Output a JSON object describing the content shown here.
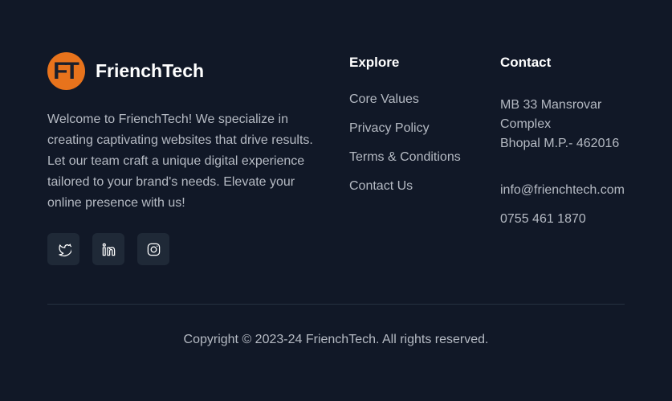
{
  "brand": {
    "logo_mark": "FT",
    "name": "FrienchTech",
    "logo_color": "#e8731c"
  },
  "about": {
    "text": "Welcome to FrienchTech! We specialize in creating captivating websites that drive results. Let our team craft a unique digital experience tailored to your brand's needs. Elevate your online presence with us!"
  },
  "socials": [
    {
      "icon": "twitter-icon"
    },
    {
      "icon": "linkedin-icon"
    },
    {
      "icon": "instagram-icon"
    }
  ],
  "explore": {
    "title": "Explore",
    "links": [
      "Core Values",
      "Privacy Policy",
      "Terms & Conditions",
      "Contact Us"
    ]
  },
  "contact": {
    "title": "Contact",
    "address_line1": "MB 33 Mansrovar",
    "address_line2": "Complex",
    "address_line3": "Bhopal M.P.- 462016",
    "email": "info@frienchtech.com",
    "phone": "0755 461 1870"
  },
  "footer": {
    "copyright": "Copyright © 2023-24 FrienchTech. All rights reserved."
  },
  "colors": {
    "background": "#111827",
    "text": "#b5bac3",
    "heading": "#ffffff",
    "social_bg": "#1f2937"
  }
}
